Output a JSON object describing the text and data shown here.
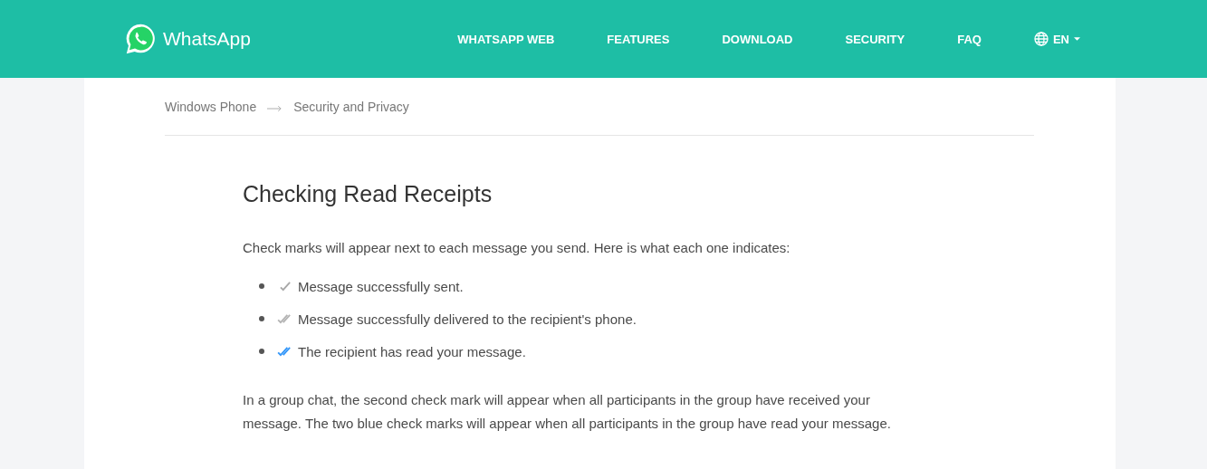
{
  "header": {
    "brand": "WhatsApp",
    "nav": [
      {
        "label": "WHATSAPP WEB"
      },
      {
        "label": "FEATURES"
      },
      {
        "label": "DOWNLOAD"
      },
      {
        "label": "SECURITY"
      },
      {
        "label": "FAQ"
      }
    ],
    "language": "EN"
  },
  "breadcrumb": [
    "Windows Phone",
    "Security and Privacy"
  ],
  "article": {
    "title": "Checking Read Receipts",
    "intro": "Check marks will appear next to each message you send. Here is what each one indicates:",
    "items": [
      {
        "kind": "sent",
        "text": "Message successfully sent."
      },
      {
        "kind": "delivered",
        "text": "Message successfully delivered to the recipient's phone."
      },
      {
        "kind": "read",
        "text": "The recipient has read your message."
      }
    ],
    "note": "In a group chat, the second check mark will appear when all participants in the group have received your message. The two blue check marks will appear when all participants in the group have read your message."
  }
}
